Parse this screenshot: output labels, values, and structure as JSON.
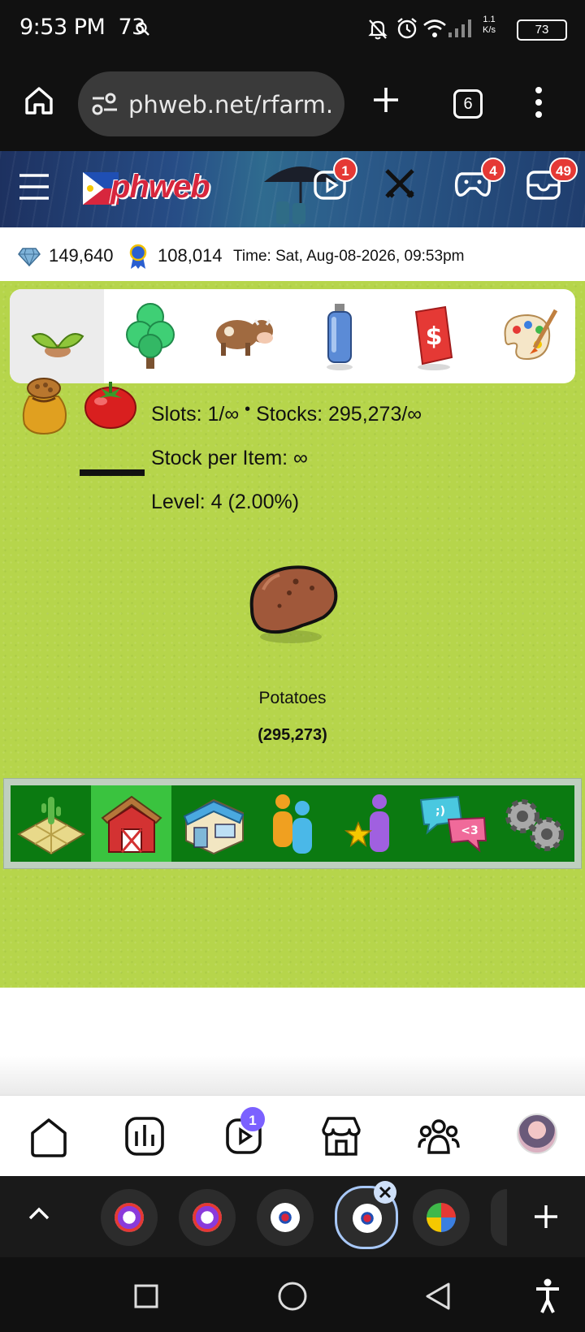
{
  "status_bar": {
    "time": "9:53 PM",
    "temp": "73",
    "speed_top": "1.1",
    "speed_bottom": "K/s",
    "battery": "73"
  },
  "browser": {
    "url": "phweb.net/rfarm.",
    "tab_count": "6"
  },
  "header": {
    "logo_text": "phweb",
    "badges": {
      "reels": "1",
      "games": "4",
      "messages": "49"
    }
  },
  "info": {
    "gems": "149,640",
    "ribbons": "108,014",
    "time": "Time: Sat, Aug-08-2026, 09:53pm"
  },
  "stats": {
    "slots": "Slots: 1/∞",
    "dot": "•",
    "stocks": "Stocks: 295,273/∞",
    "stock_per_item": "Stock per Item: ∞",
    "level": "Level: 4 (2.00%)"
  },
  "product": {
    "name": "Potatoes",
    "quantity": "(295,273)"
  },
  "bottom_nav": {
    "reels_badge": "1"
  },
  "colors": {
    "grass": "#b6d54b",
    "toolbar": "#0b7a11",
    "toolbar_active": "#3ac33f",
    "badge": "#e53935",
    "nav_badge": "#7b61ff"
  }
}
